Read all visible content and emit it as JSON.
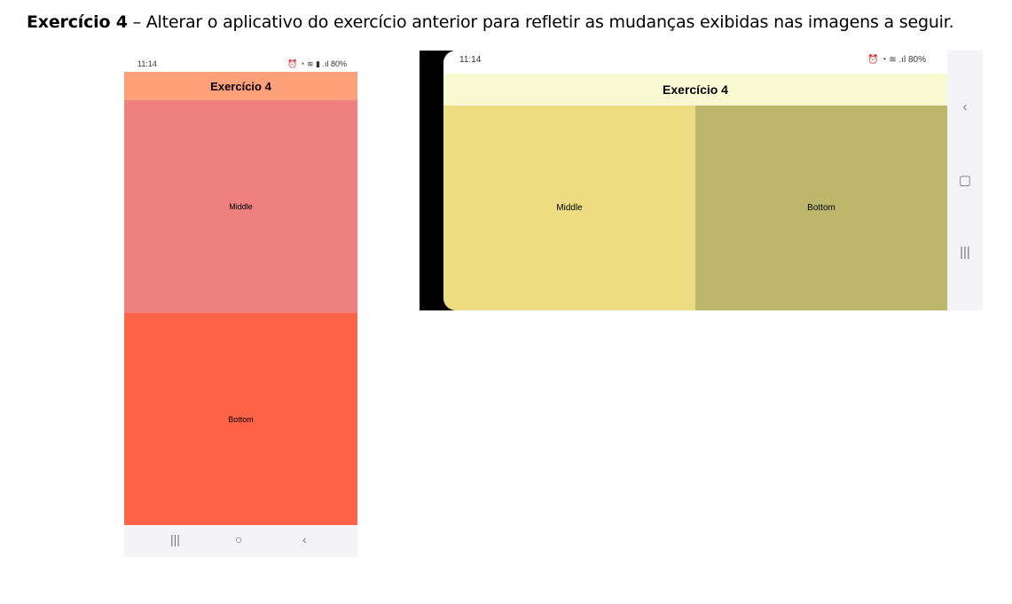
{
  "heading": {
    "bold": "Exercício 4",
    "text": " – Alterar o aplicativo do exercício anterior para refletir as mudanças exibidas nas imagens a seguir."
  },
  "portrait": {
    "status_time": "11:14",
    "status_icons": "⏰ ◔ ≋ ▮ .ıl 80%",
    "title": "Exercício 4",
    "middle_label": "Middle",
    "bottom_label": "Bottom",
    "nav": {
      "recents": "|||",
      "home": "○",
      "back": "‹"
    },
    "colors": {
      "appbar": "#ffa07a",
      "middle": "#f08080",
      "bottom": "#ff6347"
    }
  },
  "landscape": {
    "status_time": "11:14",
    "status_icons": "⏰ ◔ ≋ .ıl 80%",
    "title": "Exercício 4",
    "middle_label": "Middle",
    "bottom_label": "Bottom",
    "nav": {
      "back": "‹",
      "home": "▢",
      "recents": "|||"
    },
    "colors": {
      "appbar": "#fafad2",
      "middle": "#eedc82",
      "bottom": "#bdb76b"
    }
  }
}
